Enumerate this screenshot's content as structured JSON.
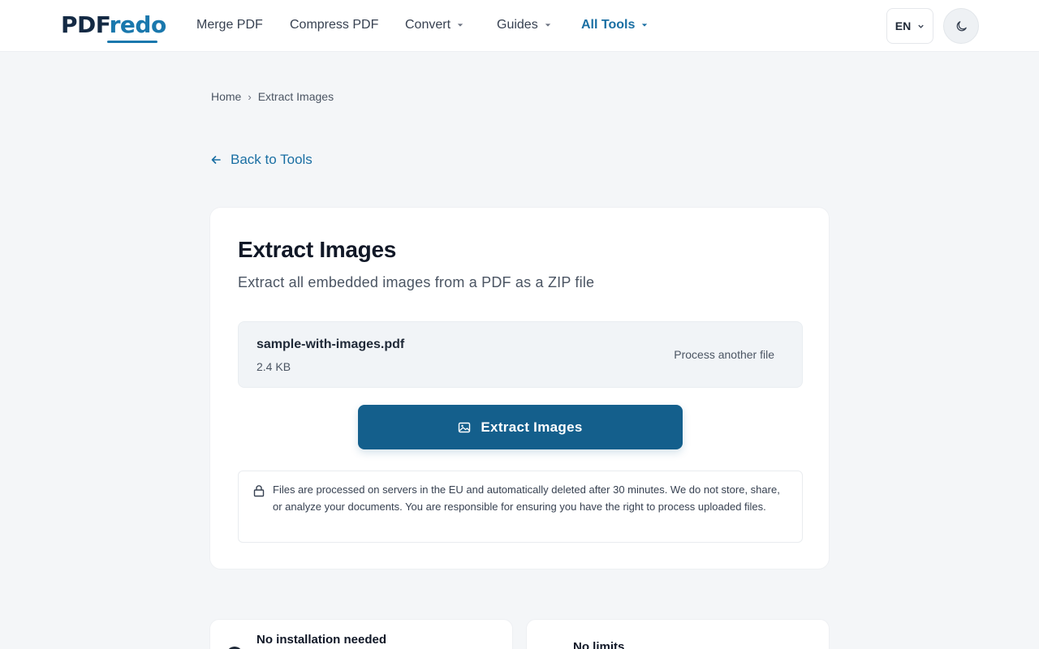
{
  "header": {
    "logo_part1": "PDF",
    "logo_part2": "redo",
    "nav": [
      {
        "label": "Merge PDF"
      },
      {
        "label": "Compress PDF"
      },
      {
        "label": "Convert"
      },
      {
        "label": "Guides"
      },
      {
        "label": "All Tools"
      }
    ],
    "language": "EN",
    "theme_icon": "moon-icon",
    "colors": {
      "brand": "#1a78ad",
      "logo_dark": "#142a44",
      "accent": "#1a6fa3"
    }
  },
  "breadcrumb": {
    "home": "Home",
    "current": "Extract Images"
  },
  "back_link": "Back to Tools",
  "tool": {
    "title": "Extract Images",
    "subtitle": "Extract all embedded images from a PDF as a ZIP file",
    "file": {
      "name": "sample-with-images.pdf",
      "size": "2.4 KB"
    },
    "process_another": "Process another file",
    "action_button": "Extract Images",
    "action_color": "#145f8c",
    "privacy_notice": "Files are processed on servers in the EU and automatically deleted after 30 minutes. We do not store, share, or analyze your documents. You are responsible for ensuring you have the right to process uploaded files."
  },
  "features": [
    {
      "title": "No installation needed"
    },
    {
      "title": "No limits"
    }
  ]
}
